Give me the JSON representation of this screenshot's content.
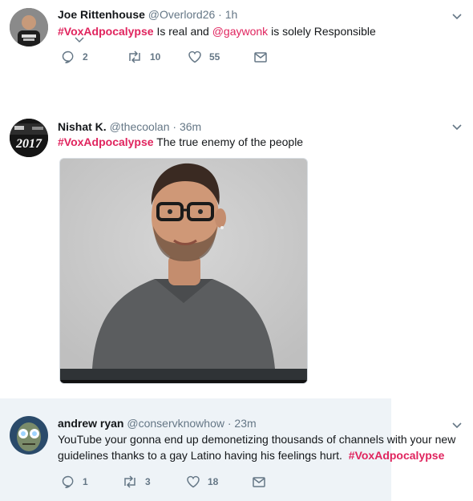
{
  "colors": {
    "accent": "#e0245e",
    "muted": "#657786",
    "text": "#14171a",
    "highlight_bg": "#eef3f7"
  },
  "tweets": [
    {
      "name": "Joe Rittenhouse",
      "handle": "@Overlord26",
      "time": "· 1h",
      "hashtag": "#VoxAdpocalypse",
      "text_1": " Is real and ",
      "mention": "@gaywonk",
      "text_2": " is solely Responsible",
      "replies": "2",
      "retweets": "10",
      "likes": "55",
      "icons": [
        "reply-icon",
        "retweet-icon",
        "like-icon",
        "dm-icon",
        "chevron-down-icon"
      ]
    },
    {
      "name": "Nishat K.",
      "handle": "@thecoolan",
      "time": "· 36m",
      "avatar_text": "2017",
      "hashtag": "#VoxAdpocalypse",
      "text_1": " The true enemy of the people",
      "icons": [
        "chevron-down-icon"
      ]
    },
    {
      "name": "andrew ryan",
      "handle": "@conservknowhow",
      "time": "· 23m",
      "text_1": "YouTube your gonna end up demonetizing thousands of channels with your new",
      "text_2": "guidelines thanks to a gay Latino having his feelings hurt. ",
      "hashtag": "#VoxAdpocalypse",
      "replies": "1",
      "retweets": "3",
      "likes": "18",
      "icons": [
        "reply-icon",
        "retweet-icon",
        "like-icon",
        "dm-icon",
        "chevron-down-icon"
      ]
    }
  ]
}
